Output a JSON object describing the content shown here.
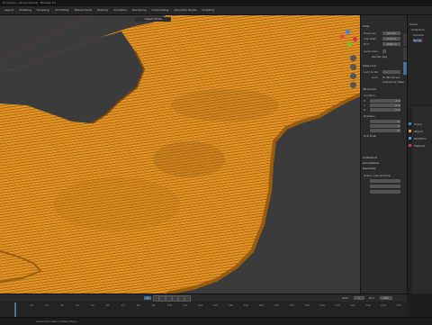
{
  "window": {
    "title": "[C:\\Users\\...\\terrain.blend] - Blender 3.x"
  },
  "menu": [
    "Layout",
    "Modeling",
    "Sculpting",
    "UV Editing",
    "Texture Paint",
    "Shading",
    "Animation",
    "Rendering",
    "Compositing",
    "Geometry Nodes",
    "Scripting"
  ],
  "viewport": {
    "header_mode": "Object Mode",
    "gizmo_colors": {
      "x": "#e84a4a",
      "y": "#72c23a",
      "z": "#4a7fe8"
    },
    "terrain_color": "#f5a623"
  },
  "npanel": {
    "section_view": "View",
    "focal_length_label": "Focal Len",
    "focal_length_value": "50 mm",
    "clip_start_label": "Clip Start",
    "clip_start_value": "0.01 m",
    "clip_end_label": "End",
    "clip_end_value": "1000 m",
    "local_camera_label": "Local Cam",
    "render_region_label": "Render Reg",
    "view_lock_label": "View Lock",
    "lock_to_object_label": "Lock to Ob",
    "lock_label": "Lock",
    "to_3d_cursor_label": "To 3D Cursor",
    "camera_to_view_label": "Camera to View",
    "section_3d_cursor": "3D Cursor",
    "location_label": "Location",
    "x_label": "X",
    "x_value": "0 m",
    "y_label": "Y",
    "y_value": "0 m",
    "z_label": "Z",
    "z_value": "0 m",
    "rotation_label": "Rotation",
    "rx_value": "0°",
    "ry_value": "0°",
    "rz_value": "0°",
    "rotation_mode": "XYZ Euler",
    "collections": "Collections",
    "annotations": "Annotations",
    "geometry": "Geometry",
    "note_label": "Scene view shading",
    "tab_labels": [
      "Item",
      "Tool",
      "View"
    ]
  },
  "outliner": {
    "items": [
      "Scene",
      "Collection",
      "Camera",
      "Terrain"
    ]
  },
  "properties": {
    "items": [
      "Scene",
      "Object",
      "Modifiers",
      "Material"
    ]
  },
  "timeline": {
    "ticks": [
      "0",
      "10",
      "20",
      "30",
      "40",
      "50",
      "60",
      "70",
      "80",
      "90",
      "100",
      "110",
      "120",
      "130",
      "140",
      "150",
      "160",
      "170",
      "180",
      "190",
      "200",
      "210",
      "220",
      "230",
      "240",
      "250"
    ],
    "start_label": "Start",
    "start_value": "1",
    "end_label": "End",
    "end_value": "250",
    "current_frame": "1"
  },
  "statusbar": {
    "text": "Select    Pan View    Context Menu"
  }
}
